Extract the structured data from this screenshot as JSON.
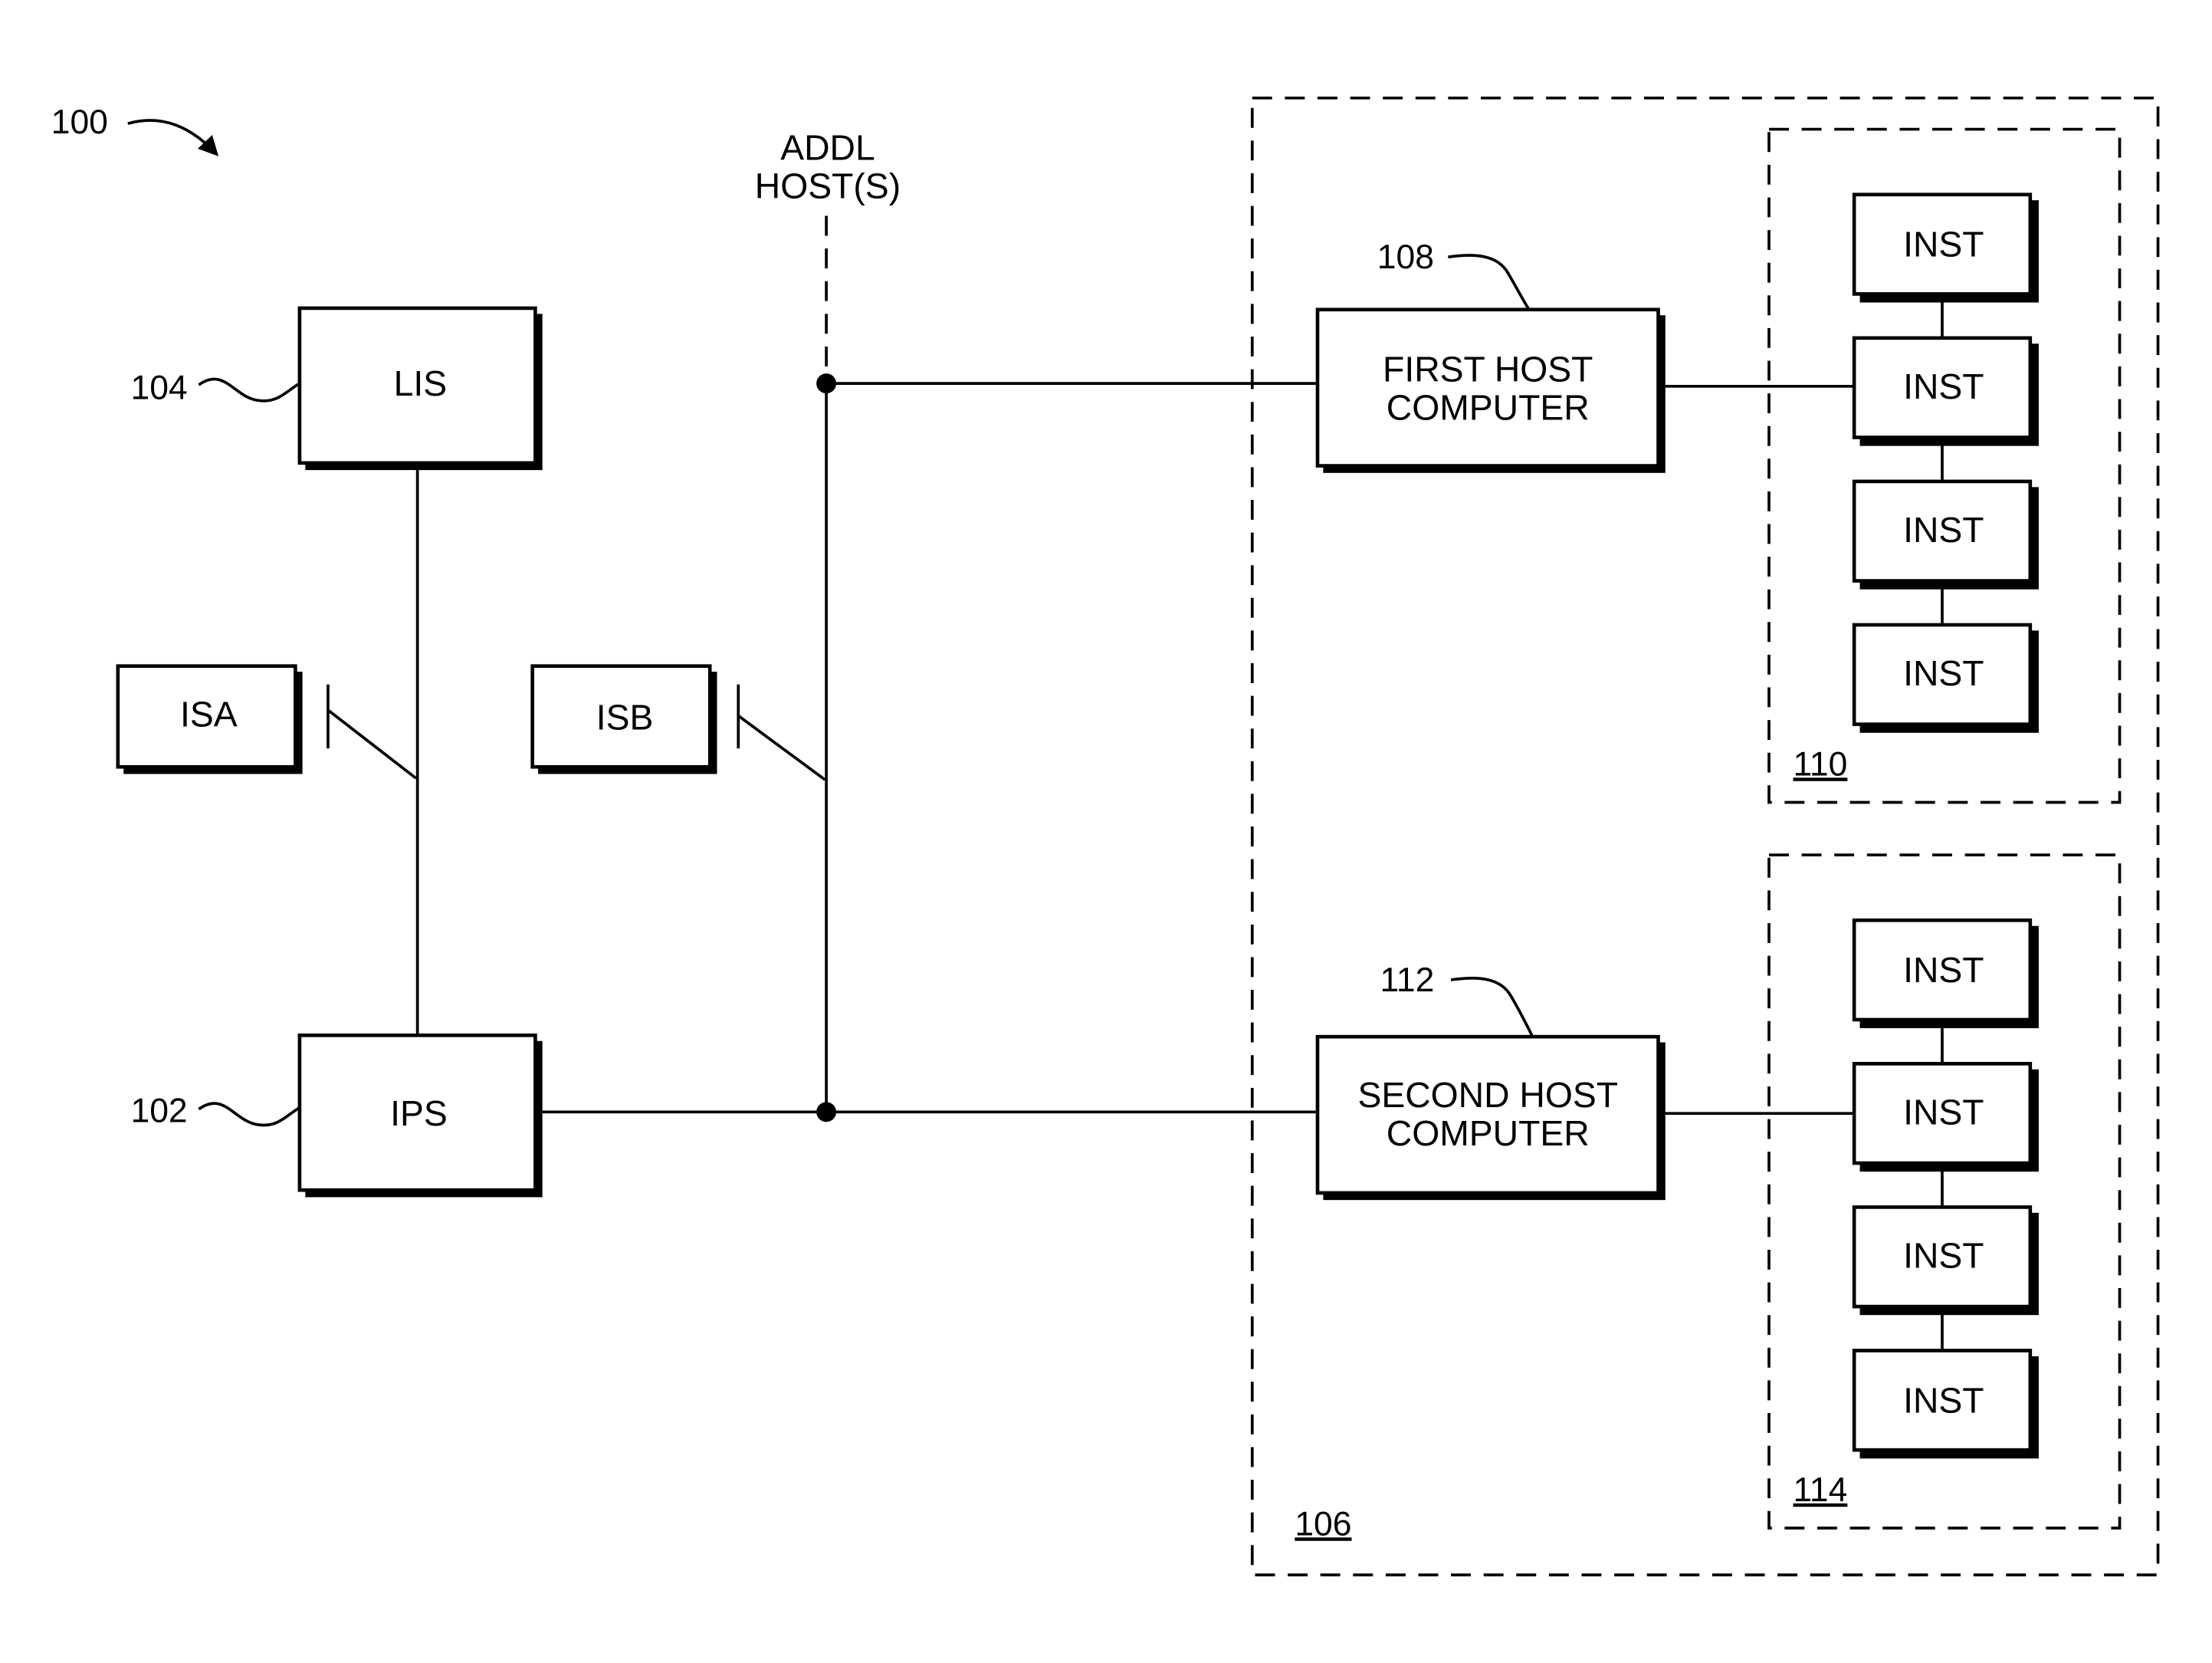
{
  "figure_ref": "100",
  "addl_hosts": {
    "line1": "ADDL",
    "line2": "HOST(S)"
  },
  "blocks": {
    "lis": {
      "label": "LIS",
      "ref": "104"
    },
    "ips": {
      "label": "IPS",
      "ref": "102"
    },
    "isa": {
      "label": "ISA"
    },
    "isb": {
      "label": "ISB"
    },
    "first_host": {
      "line1": "FIRST HOST",
      "line2": "COMPUTER",
      "ref": "108"
    },
    "second_host": {
      "line1": "SECOND HOST",
      "line2": "COMPUTER",
      "ref": "112"
    }
  },
  "groups": {
    "outer": {
      "ref": "106"
    },
    "inst_group_1": {
      "ref": "110",
      "items": [
        "INST",
        "INST",
        "INST",
        "INST"
      ]
    },
    "inst_group_2": {
      "ref": "114",
      "items": [
        "INST",
        "INST",
        "INST",
        "INST"
      ]
    }
  }
}
